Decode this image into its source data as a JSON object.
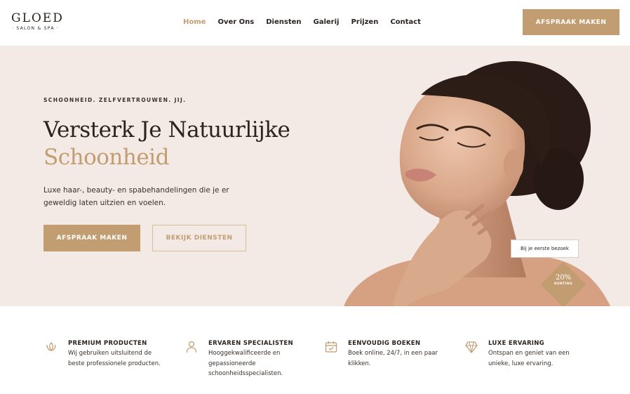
{
  "brand": {
    "name": "GLOED",
    "sub": "· SALON & SPA ·"
  },
  "nav": {
    "items": [
      {
        "label": "Home",
        "active": true
      },
      {
        "label": "Over Ons",
        "active": false
      },
      {
        "label": "Diensten",
        "active": false
      },
      {
        "label": "Galerij",
        "active": false
      },
      {
        "label": "Prijzen",
        "active": false
      },
      {
        "label": "Contact",
        "active": false
      }
    ],
    "cta": "AFSPRAAK MAKEN"
  },
  "hero": {
    "tagline": "SCHOONHEID. ZELFVERTROUWEN. JIJ.",
    "title_line1": "Versterk Je Natuurlijke",
    "title_line2": "Schoonheid",
    "description": "Luxe haar-, beauty- en spabehandelingen die je er geweldig laten uitzien en voelen.",
    "primary_button": "AFSPRAAK MAKEN",
    "secondary_button": "BEKIJK DIENSTEN",
    "promo_label": "Bij je eerste bezoek",
    "promo_value": "20%",
    "promo_sub": "KORTING"
  },
  "features": [
    {
      "icon": "lotus-icon",
      "title": "PREMIUM PRODUCTEN",
      "desc": "Wij gebruiken uitsluitend de beste professionele producten."
    },
    {
      "icon": "person-icon",
      "title": "ERVAREN SPECIALISTEN",
      "desc": "Hooggekwalificeerde en gepassioneerde schoonheidsspecialisten."
    },
    {
      "icon": "calendar-check-icon",
      "title": "EENVOUDIG BOEKEN",
      "desc": "Boek online, 24/7, in een paar klikken."
    },
    {
      "icon": "diamond-icon",
      "title": "LUXE ERVARING",
      "desc": "Ontspan en geniet van een unieke, luxe ervaring."
    }
  ],
  "colors": {
    "accent": "#c29d72",
    "hero_bg": "#f3e9e5",
    "text": "#2b2320"
  }
}
